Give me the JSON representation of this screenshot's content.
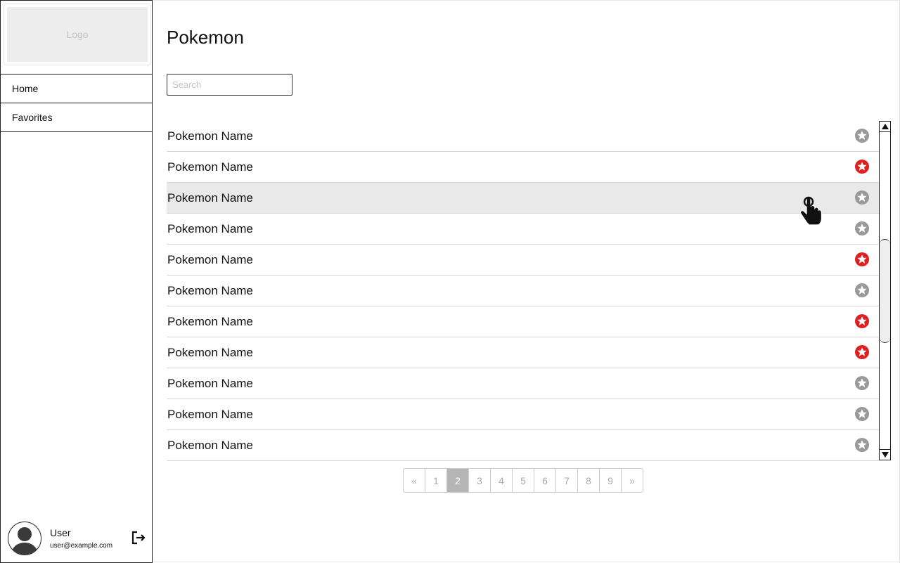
{
  "sidebar": {
    "logo": "Logo",
    "items": [
      {
        "label": "Home"
      },
      {
        "label": "Favorites"
      }
    ],
    "user": {
      "name": "User",
      "email": "user@example.com"
    },
    "logout_icon": "logout-icon"
  },
  "main": {
    "title": "Pokemon",
    "search": {
      "placeholder": "Search",
      "value": ""
    },
    "rows": [
      {
        "name": "Pokemon Name",
        "favorite": false
      },
      {
        "name": "Pokemon Name",
        "favorite": true
      },
      {
        "name": "Pokemon Name",
        "favorite": false,
        "hover": true
      },
      {
        "name": "Pokemon Name",
        "favorite": false
      },
      {
        "name": "Pokemon Name",
        "favorite": true
      },
      {
        "name": "Pokemon Name",
        "favorite": false
      },
      {
        "name": "Pokemon Name",
        "favorite": true
      },
      {
        "name": "Pokemon Name",
        "favorite": true
      },
      {
        "name": "Pokemon Name",
        "favorite": false
      },
      {
        "name": "Pokemon Name",
        "favorite": false
      },
      {
        "name": "Pokemon Name",
        "favorite": false
      }
    ],
    "pagination": {
      "prev": "«",
      "pages": [
        "1",
        "2",
        "3",
        "4",
        "5",
        "6",
        "7",
        "8",
        "9"
      ],
      "current": "2",
      "next": "»"
    }
  },
  "colors": {
    "favorite": "#e02020",
    "not_favorite": "#999999",
    "hover_row": "#e9e9e9",
    "active_page": "#b5b5b5"
  }
}
